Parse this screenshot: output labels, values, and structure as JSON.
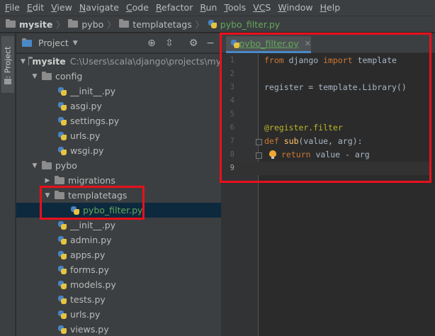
{
  "menu": [
    {
      "u": "F",
      "rest": "ile"
    },
    {
      "u": "E",
      "rest": "dit"
    },
    {
      "u": "V",
      "rest": "iew"
    },
    {
      "u": "N",
      "rest": "avigate"
    },
    {
      "u": "C",
      "rest": "ode"
    },
    {
      "u": "R",
      "rest": "efactor"
    },
    {
      "u": "R",
      "rest": "un"
    },
    {
      "u": "T",
      "rest": "ools"
    },
    {
      "u": "VC",
      "rest": "S"
    },
    {
      "u": "W",
      "rest": "indow"
    },
    {
      "u": "H",
      "rest": "elp"
    }
  ],
  "breadcrumb": [
    "mysite",
    "pybo",
    "templatetags",
    "pybo_filter.py"
  ],
  "side_tab": "1: Project",
  "project_panel": {
    "title": "Project",
    "root_name": "mysite",
    "root_path": "C:\\Users\\scala\\django\\projects\\my"
  },
  "tree": {
    "config": "config",
    "config_init": "__init__.py",
    "config_asgi": "asgi.py",
    "config_settings": "settings.py",
    "config_urls": "urls.py",
    "config_wsgi": "wsgi.py",
    "pybo": "pybo",
    "migrations": "migrations",
    "templatetags": "templatetags",
    "pybo_filter": "pybo_filter.py",
    "pybo_init": "__init__.py",
    "admin": "admin.py",
    "apps": "apps.py",
    "forms": "forms.py",
    "models": "models.py",
    "tests": "tests.py",
    "urls": "urls.py",
    "views": "views.py"
  },
  "editor": {
    "tab_label": "pybo_filter.py",
    "line_numbers": [
      "1",
      "2",
      "3",
      "4",
      "5",
      "6",
      "7",
      "8",
      "9"
    ],
    "code": {
      "l1_from": "from",
      "l1_mod": " django ",
      "l1_import": "import",
      "l1_name": " template",
      "l3": "register = template.Library()",
      "l6": "@register.filter",
      "l7_def": "def",
      "l7_name": "sub",
      "l7_args": "(value, arg):",
      "l8_return": "return",
      "l8_expr": " value - arg"
    }
  }
}
